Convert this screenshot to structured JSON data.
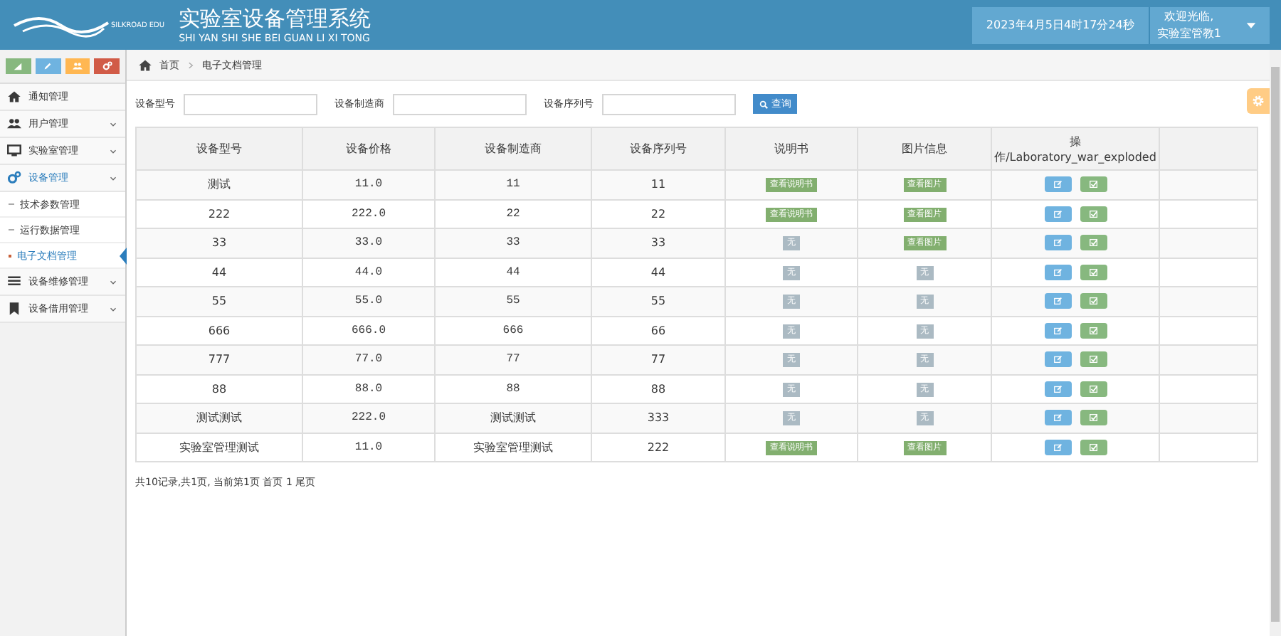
{
  "header": {
    "title": "实验室设备管理系统",
    "subtitle": "SHI YAN SHI SHE BEI GUAN LI XI TONG",
    "logo_text": "SILKROAD EDU",
    "datetime": "2023年4月5日4时17分24秒",
    "welcome": "欢迎光临,",
    "user": "实验室管教1"
  },
  "shortcuts": [
    {
      "kind": "chart",
      "color": "#87b87f"
    },
    {
      "kind": "pencil",
      "color": "#6fb3e0"
    },
    {
      "kind": "users",
      "color": "#ffb752"
    },
    {
      "kind": "cogs",
      "color": "#d15b47"
    }
  ],
  "sidebar": {
    "items": [
      {
        "label": "通知管理",
        "has_arrow": false,
        "expanded": false
      },
      {
        "label": "用户管理",
        "has_arrow": true,
        "expanded": false
      },
      {
        "label": "实验室管理",
        "has_arrow": true,
        "expanded": false
      },
      {
        "label": "设备管理",
        "has_arrow": true,
        "expanded": true,
        "children": [
          {
            "label": "技术参数管理",
            "selected": false
          },
          {
            "label": "运行数据管理",
            "selected": false
          },
          {
            "label": "电子文档管理",
            "selected": true
          }
        ]
      },
      {
        "label": "设备维修管理",
        "has_arrow": true,
        "expanded": false
      },
      {
        "label": "设备借用管理",
        "has_arrow": true,
        "expanded": false
      }
    ]
  },
  "breadcrumb": [
    "首页",
    "电子文档管理"
  ],
  "search": {
    "fields": [
      {
        "label": "设备型号"
      },
      {
        "label": "设备制造商"
      },
      {
        "label": "设备序列号"
      }
    ],
    "button": "查询"
  },
  "table": {
    "columns": [
      "设备型号",
      "设备价格",
      "设备制造商",
      "设备序列号",
      "说明书",
      "图片信息",
      "操作/Laboratory_war_exploded"
    ],
    "rows": [
      {
        "cells": [
          "测试",
          "11.0",
          "11",
          "11"
        ],
        "manual": {
          "label": "查看说明书",
          "available": true
        },
        "picture": {
          "label": "查看图片",
          "available": true
        }
      },
      {
        "cells": [
          "222",
          "222.0",
          "22",
          "22"
        ],
        "manual": {
          "label": "查看说明书",
          "available": true
        },
        "picture": {
          "label": "查看图片",
          "available": true
        }
      },
      {
        "cells": [
          "33",
          "33.0",
          "33",
          "33"
        ],
        "manual": {
          "label": "无",
          "available": false
        },
        "picture": {
          "label": "查看图片",
          "available": true
        }
      },
      {
        "cells": [
          "44",
          "44.0",
          "44",
          "44"
        ],
        "manual": {
          "label": "无",
          "available": false
        },
        "picture": {
          "label": "无",
          "available": false
        }
      },
      {
        "cells": [
          "55",
          "55.0",
          "55",
          "55"
        ],
        "manual": {
          "label": "无",
          "available": false
        },
        "picture": {
          "label": "无",
          "available": false
        }
      },
      {
        "cells": [
          "666",
          "666.0",
          "666",
          "66"
        ],
        "manual": {
          "label": "无",
          "available": false
        },
        "picture": {
          "label": "无",
          "available": false
        }
      },
      {
        "cells": [
          "777",
          "77.0",
          "77",
          "77"
        ],
        "manual": {
          "label": "无",
          "available": false
        },
        "picture": {
          "label": "无",
          "available": false
        }
      },
      {
        "cells": [
          "88",
          "88.0",
          "88",
          "88"
        ],
        "manual": {
          "label": "无",
          "available": false
        },
        "picture": {
          "label": "无",
          "available": false
        }
      },
      {
        "cells": [
          "测试测试",
          "222.0",
          "测试测试",
          "333"
        ],
        "manual": {
          "label": "无",
          "available": false
        },
        "picture": {
          "label": "无",
          "available": false
        }
      },
      {
        "cells": [
          "实验室管理测试",
          "11.0",
          "实验室管理测试",
          "222"
        ],
        "manual": {
          "label": "查看说明书",
          "available": true
        },
        "picture": {
          "label": "查看图片",
          "available": true
        }
      }
    ]
  },
  "pagination": "共10记录,共1页, 当前第1页 首页 1 尾页"
}
